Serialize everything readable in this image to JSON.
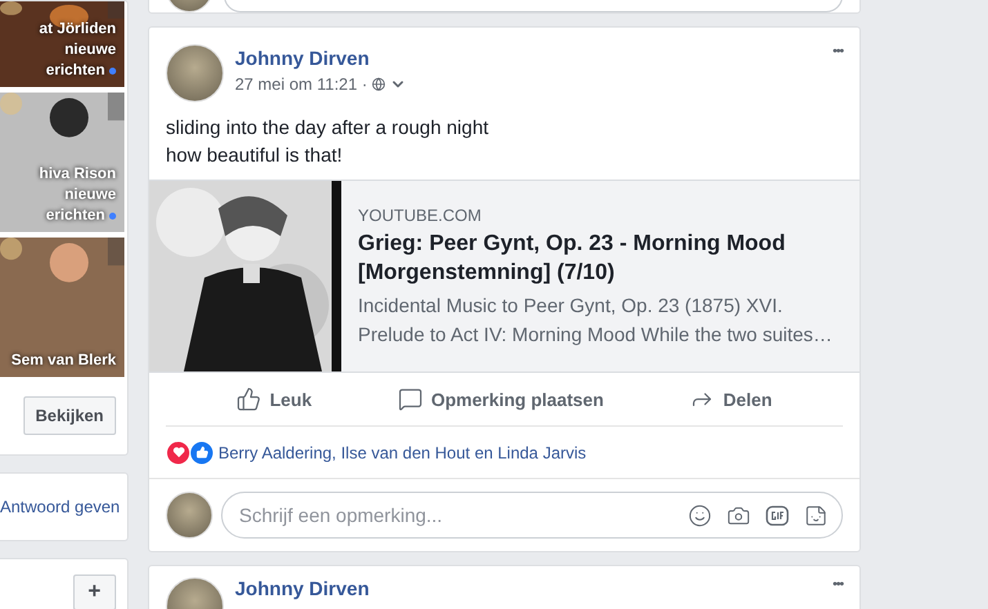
{
  "sidebar": {
    "stories": [
      {
        "name": "at Jörliden",
        "line2": "nieuwe",
        "line3": "erichten"
      },
      {
        "name": "hiva Rison",
        "line2": "nieuwe",
        "line3": "erichten"
      },
      {
        "name": "Sem van Blerk"
      }
    ],
    "view_button": "Bekijken",
    "reply_link": "Antwoord geven",
    "add_button": "+"
  },
  "post": {
    "author": "Johnny Dirven",
    "time": "27 mei om 11:21 ·",
    "more": "•••",
    "text_lines": [
      "sliding into the day after a rough night",
      "how beautiful is that!"
    ],
    "link": {
      "kind": "picture",
      "domain": "YOUTUBE.COM",
      "title": "Grieg: Peer Gynt, Op. 23 - Morning Mood [Morgenstemning] (7/10)",
      "description": "Incidental Music to Peer Gynt, Op. 23 (1875) XVI. Prelude to Act IV: Morning Mood While the two suites…"
    },
    "actions": [
      {
        "kind": "like",
        "label": "Leuk"
      },
      {
        "kind": "comment",
        "label": "Opmerking plaatsen"
      },
      {
        "kind": "share",
        "label": "Delen"
      }
    ],
    "reactions": {
      "types": [
        {
          "kind": "love",
          "color": "#f0284a"
        },
        {
          "kind": "like",
          "color": "#1877f2"
        }
      ],
      "names": "Berry Aaldering, Ilse van den Hout en Linda Jarvis"
    },
    "comment_placeholder": "Schrijf een opmerking..."
  },
  "next_post": {
    "author": "Johnny Dirven",
    "more": "•••"
  }
}
